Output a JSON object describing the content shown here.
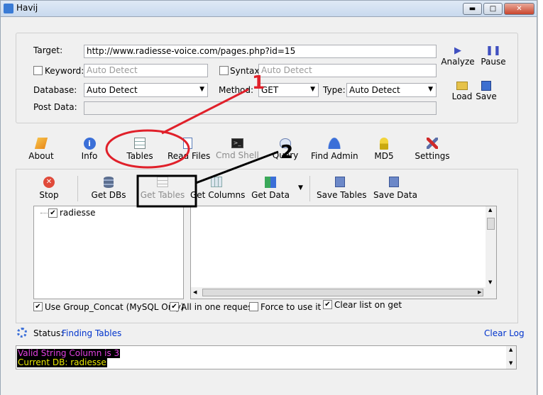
{
  "window": {
    "title": "Havij",
    "min_label": "▬",
    "max_label": "□",
    "close_label": "✕"
  },
  "form": {
    "target_label": "Target:",
    "target_value": "http://www.radiesse-voice.com/pages.php?id=15",
    "keyword_label": "Keyword:",
    "keyword_placeholder": "Auto Detect",
    "syntax_label": "Syntax:",
    "syntax_placeholder": "Auto Detect",
    "database_label": "Database:",
    "database_value": "Auto Detect",
    "method_label": "Method:",
    "method_value": "GET",
    "type_label": "Type:",
    "type_value": "Auto Detect",
    "postdata_label": "Post Data:"
  },
  "actions": {
    "analyze": "Analyze",
    "pause": "Pause",
    "load": "Load",
    "save": "Save"
  },
  "main_toolbar": [
    "About",
    "Info",
    "Tables",
    "Read Files",
    "Cmd Shell",
    "Query",
    "Find Admin",
    "MD5",
    "Settings"
  ],
  "tables_toolbar": [
    "Stop",
    "Get DBs",
    "Get Tables",
    "Get Columns",
    "Get Data",
    "Save Tables",
    "Save Data"
  ],
  "tree": {
    "db_name": "radiesse"
  },
  "options": {
    "group_concat": "Use Group_Concat (MySQL Only)",
    "all_in_one": "All in one request.",
    "force": "Force to use it",
    "clear_list": "Clear list on get"
  },
  "status": {
    "label": "Status:",
    "value": "Finding Tables",
    "clear_log": "Clear Log"
  },
  "log": {
    "line1": "Valid String Column is 3",
    "line2": "Current DB: radiesse"
  },
  "annotations": {
    "one": "1",
    "two": "2"
  },
  "colors": {
    "annotation_red": "#e0202a",
    "log_magenta": "#e040e0",
    "log_yellow": "#e8e800",
    "link_blue": "#0033cc"
  }
}
